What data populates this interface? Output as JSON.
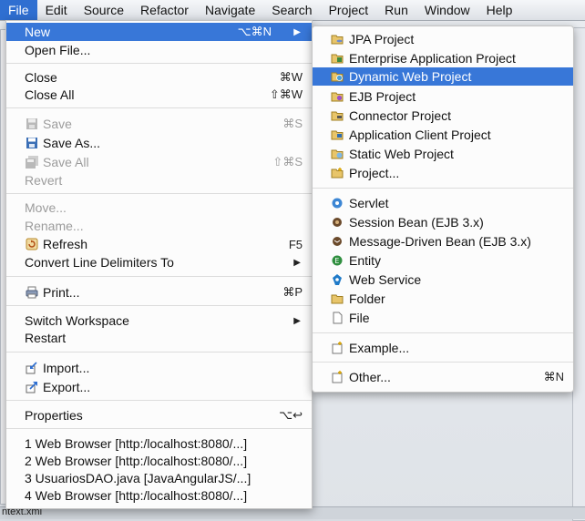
{
  "menubar": {
    "items": [
      "File",
      "Edit",
      "Source",
      "Refactor",
      "Navigate",
      "Search",
      "Project",
      "Run",
      "Window",
      "Help"
    ]
  },
  "file_menu": {
    "new": {
      "label": "New",
      "shortcut": "⌥⌘N"
    },
    "open_file": "Open File...",
    "close": {
      "label": "Close",
      "shortcut": "⌘W"
    },
    "close_all": {
      "label": "Close All",
      "shortcut": "⇧⌘W"
    },
    "save": {
      "label": "Save",
      "shortcut": "⌘S"
    },
    "save_as": "Save As...",
    "save_all": {
      "label": "Save All",
      "shortcut": "⇧⌘S"
    },
    "revert": "Revert",
    "move": "Move...",
    "rename": "Rename...",
    "refresh": {
      "label": "Refresh",
      "shortcut": "F5"
    },
    "convert_line_delimiters": "Convert Line Delimiters To",
    "print": {
      "label": "Print...",
      "shortcut": "⌘P"
    },
    "switch_workspace": "Switch Workspace",
    "restart": "Restart",
    "import": "Import...",
    "export": "Export...",
    "properties": {
      "label": "Properties",
      "shortcut": "⌥↩"
    },
    "recent": [
      "1 Web Browser  [http:/localhost:8080/...]",
      "2 Web Browser  [http:/localhost:8080/...]",
      "3 UsuariosDAO.java  [JavaAngularJS/...]",
      "4 Web Browser  [http:/localhost:8080/...]"
    ]
  },
  "new_submenu": {
    "jpa_project": "JPA Project",
    "enterprise_application_project": "Enterprise Application Project",
    "dynamic_web_project": "Dynamic Web Project",
    "ejb_project": "EJB Project",
    "connector_project": "Connector Project",
    "application_client_project": "Application Client Project",
    "static_web_project": "Static Web Project",
    "project": "Project...",
    "servlet": "Servlet",
    "session_bean": "Session Bean (EJB 3.x)",
    "message_driven_bean": "Message-Driven Bean (EJB 3.x)",
    "entity": "Entity",
    "web_service": "Web Service",
    "folder": "Folder",
    "file": "File",
    "example": "Example...",
    "other": {
      "label": "Other...",
      "shortcut": "⌘N"
    }
  },
  "background": {
    "status_text": "ntext.xml"
  },
  "colors": {
    "highlight": "#3877d8",
    "menubar_active": "#2f6fd1",
    "disabled_text": "#9c9c9c"
  }
}
